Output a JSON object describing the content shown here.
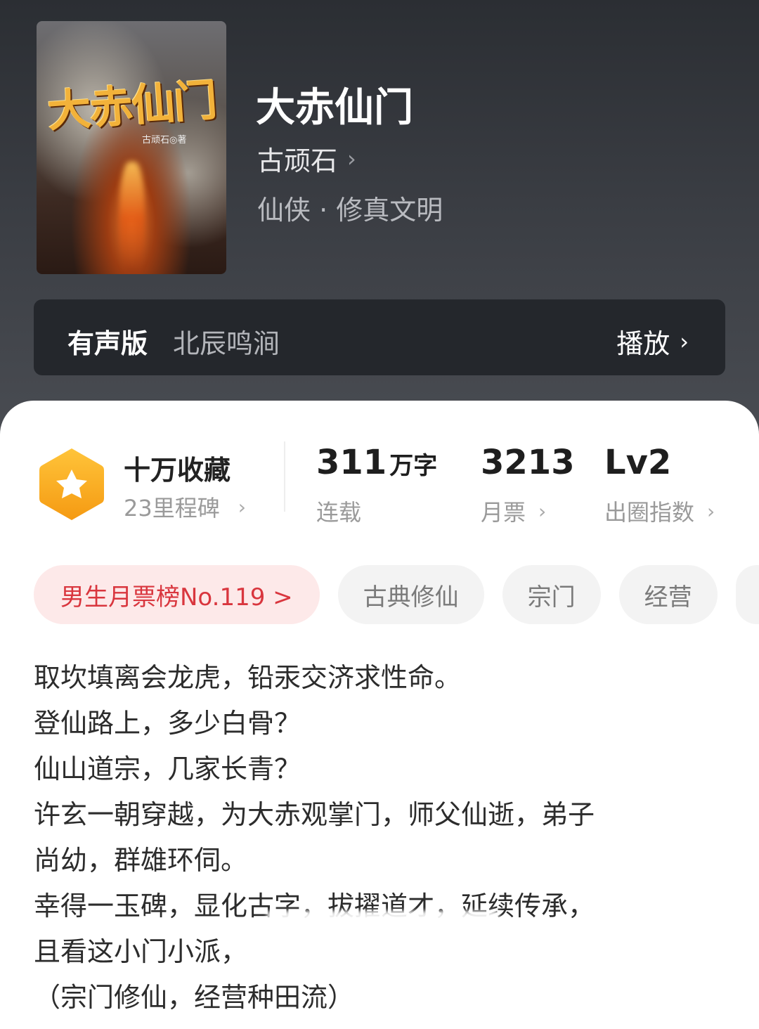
{
  "book": {
    "cover_title": "大赤仙门",
    "cover_author": "古顽石◎著",
    "title": "大赤仙门",
    "author": "古顽石",
    "genre": "仙侠 · 修真文明"
  },
  "audio": {
    "label": "有声版",
    "narrator": "北辰鸣涧",
    "play_label": "播放"
  },
  "stats": {
    "favorites_title": "十万收藏",
    "milestones": "23里程碑",
    "words_value": "311",
    "words_unit": "万字",
    "status": "连载",
    "monthly_votes": "3213",
    "monthly_votes_label": "月票",
    "influence_value": "Lv2",
    "influence_label": "出圈指数"
  },
  "tags": {
    "rank": "男生月票榜No.119 >",
    "items": [
      "古典修仙",
      "宗门",
      "经营"
    ]
  },
  "description": [
    "取坎填离会龙虎，铅汞交济求性命。",
    "登仙路上，多少白骨？",
    "仙山道宗，几家长青？",
    "许玄一朝穿越，为大赤观掌门，师父仙逝，弟子",
    "尚幼，群雄环伺。",
    "幸得一玉碑，显化古字，拔擢道才，延续传承，",
    "且看这小门小派，",
    "（宗门修仙，经营种田流）"
  ],
  "colors": {
    "accent_red": "#d9363e",
    "badge_orange": "#f7a51c"
  }
}
